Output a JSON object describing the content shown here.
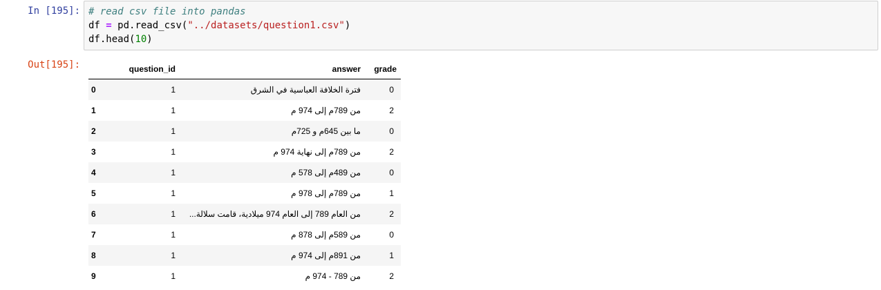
{
  "input_cell": {
    "prompt": "In [195]:",
    "code_lines": {
      "l1": "# read csv file into pandas",
      "l2_a": "df ",
      "l2_op": "=",
      "l2_b": " pd.read_csv(",
      "l2_str": "\"../datasets/question1.csv\"",
      "l2_c": ")",
      "l3_a": "df.head(",
      "l3_num": "10",
      "l3_b": ")"
    }
  },
  "output_cell": {
    "prompt": "Out[195]:",
    "dataframe": {
      "columns": [
        "",
        "question_id",
        "answer",
        "grade"
      ],
      "rows": [
        {
          "index": "0",
          "question_id": "1",
          "answer": "فترة الخلافة العباسية في الشرق",
          "grade": "0"
        },
        {
          "index": "1",
          "question_id": "1",
          "answer": "من 789م إلى 974 م",
          "grade": "2"
        },
        {
          "index": "2",
          "question_id": "1",
          "answer": "ما بين 645م و 725م",
          "grade": "0"
        },
        {
          "index": "3",
          "question_id": "1",
          "answer": "من 789م إلى نهاية 974 م",
          "grade": "2"
        },
        {
          "index": "4",
          "question_id": "1",
          "answer": "من 489م إلى 578 م",
          "grade": "0"
        },
        {
          "index": "5",
          "question_id": "1",
          "answer": "من 789م إلى 978 م",
          "grade": "1"
        },
        {
          "index": "6",
          "question_id": "1",
          "answer": "من العام 789 إلى العام 974 ميلادية، قامت سلالة...",
          "grade": "2"
        },
        {
          "index": "7",
          "question_id": "1",
          "answer": "من 589م إلى 878 م",
          "grade": "0"
        },
        {
          "index": "8",
          "question_id": "1",
          "answer": "من 891م إلى 974 م",
          "grade": "1"
        },
        {
          "index": "9",
          "question_id": "1",
          "answer": "من 789 - 974 م",
          "grade": "2"
        }
      ]
    }
  }
}
